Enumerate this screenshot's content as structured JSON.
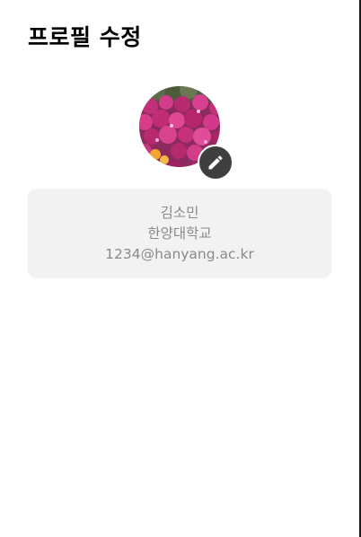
{
  "header": {
    "title": "프로필 수정"
  },
  "profile": {
    "avatar_icon": "profile-photo-flowers",
    "edit_icon": "pencil-icon",
    "name": "김소민",
    "school": "한양대학교",
    "email": "1234@hanyang.ac.kr"
  },
  "colors": {
    "edit_button_bg": "#3f3f3f",
    "card_bg": "#f2f2f2",
    "info_text": "#8a8a8a"
  }
}
